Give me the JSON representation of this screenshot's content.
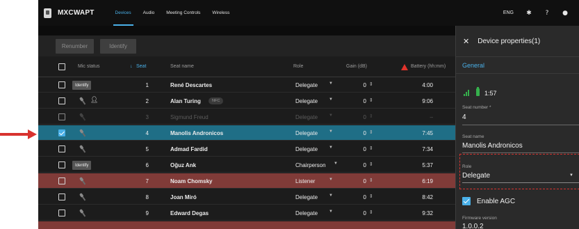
{
  "header": {
    "brand": "MXCWAPT",
    "tabs": [
      {
        "label": "Devices",
        "active": true
      },
      {
        "label": "Audio",
        "active": false
      },
      {
        "label": "Meeting Controls",
        "active": false
      },
      {
        "label": "Wireless",
        "active": false
      }
    ],
    "language": "ENG",
    "icons": {
      "settings": "gear-icon",
      "help": "help-icon",
      "user": "user-icon"
    }
  },
  "toolbar": {
    "renumber_label": "Renumber",
    "identify_label": "Identify"
  },
  "table": {
    "columns": {
      "mic_status": "Mic status",
      "seat": "Seat",
      "seat_sort_icon": "↓",
      "seat_name": "Seat name",
      "role": "Role",
      "gain": "Gain (dB)",
      "battery": "Battery (hh:mm)"
    },
    "identify_badge": "Identify",
    "nfc_badge": "NFC",
    "rows": [
      {
        "checked": false,
        "identify": true,
        "seat": "1",
        "name": "René Descartes",
        "role": "Delegate",
        "gain": "0",
        "battery": "4:00",
        "state": "normal"
      },
      {
        "checked": false,
        "speaking": true,
        "seat": "2",
        "name": "Alan Turing",
        "nfc": true,
        "role": "Delegate",
        "gain": "0",
        "battery": "9:06",
        "state": "normal"
      },
      {
        "checked": false,
        "seat": "3",
        "name": "Sigmund Freud",
        "role": "Delegate",
        "gain": "0",
        "battery": "–",
        "state": "dim"
      },
      {
        "checked": true,
        "seat": "4",
        "name": "Manolis Andronicos",
        "role": "Delegate",
        "gain": "0",
        "battery": "7:45",
        "state": "selected"
      },
      {
        "checked": false,
        "seat": "5",
        "name": "Admad Fardid",
        "role": "Delegate",
        "gain": "0",
        "battery": "7:34",
        "state": "normal"
      },
      {
        "checked": false,
        "identify": true,
        "seat": "6",
        "name": "Oğuz Ank",
        "role": "Chairperson",
        "gain": "0",
        "battery": "5:37",
        "state": "normal"
      },
      {
        "checked": false,
        "seat": "7",
        "name": "Noam Chomsky",
        "role": "Listener",
        "gain": "0",
        "battery": "6:19",
        "state": "red"
      },
      {
        "checked": false,
        "seat": "8",
        "name": "Joan Miró",
        "role": "Delegate",
        "gain": "0",
        "battery": "8:42",
        "state": "normal"
      },
      {
        "checked": false,
        "seat": "9",
        "name": "Edward Degas",
        "role": "Delegate",
        "gain": "0",
        "battery": "9:32",
        "state": "normal"
      }
    ]
  },
  "panel": {
    "title": "Device properties(1)",
    "section": "General",
    "battery_time": "1:57",
    "seat_number_label": "Seat number *",
    "seat_number_value": "4",
    "seat_name_label": "Seat name",
    "seat_name_value": "Manolis Andronicos",
    "role_label": "Role",
    "role_value": "Delegate",
    "agc_label": "Enable AGC",
    "agc_checked": true,
    "firmware_label": "Firmware version",
    "firmware_value": "1.0.0.2"
  },
  "colors": {
    "accent": "#4ab0e8",
    "selected_row": "#1f6e86",
    "alert_row": "#803b38",
    "annotation_red": "#d8322e",
    "battery_green": "#35b04c"
  }
}
